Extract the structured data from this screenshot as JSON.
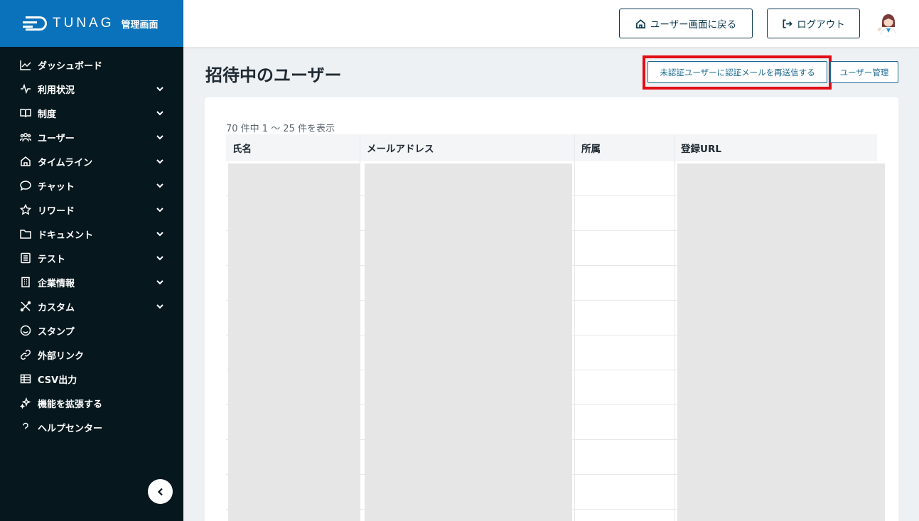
{
  "sidebar": {
    "brand_name": "TUNAG",
    "brand_sub": "管理画面",
    "items": [
      {
        "label": "ダッシュボード",
        "icon": "chart-line-icon",
        "expandable": false
      },
      {
        "label": "利用状況",
        "icon": "pulse-icon",
        "expandable": true
      },
      {
        "label": "制度",
        "icon": "book-icon",
        "expandable": true
      },
      {
        "label": "ユーザー",
        "icon": "users-icon",
        "expandable": true
      },
      {
        "label": "タイムライン",
        "icon": "home-icon",
        "expandable": true
      },
      {
        "label": "チャット",
        "icon": "chat-bubble-icon",
        "expandable": true
      },
      {
        "label": "リワード",
        "icon": "star-icon",
        "expandable": true
      },
      {
        "label": "ドキュメント",
        "icon": "folder-icon",
        "expandable": true
      },
      {
        "label": "テスト",
        "icon": "checklist-icon",
        "expandable": true
      },
      {
        "label": "企業情報",
        "icon": "building-icon",
        "expandable": true
      },
      {
        "label": "カスタム",
        "icon": "tools-icon",
        "expandable": true
      },
      {
        "label": "スタンプ",
        "icon": "smiley-icon",
        "expandable": false
      },
      {
        "label": "外部リンク",
        "icon": "link-icon",
        "expandable": false
      },
      {
        "label": "CSV出力",
        "icon": "table-icon",
        "expandable": false
      },
      {
        "label": "機能を拡張する",
        "icon": "sparkle-icon",
        "expandable": false
      },
      {
        "label": "ヘルプセンター",
        "icon": "question-icon",
        "expandable": false
      }
    ]
  },
  "header": {
    "back_to_user_label": "ユーザー画面に戻る",
    "logout_label": "ログアウト"
  },
  "main": {
    "page_title": "招待中のユーザー",
    "resend_button_label": "未認証ユーザーに認証メールを再送信する",
    "user_mgmt_button_label": "ユーザー管理",
    "count_text": "70 件中 1 〜 25 件を表示",
    "table": {
      "columns": [
        "氏名",
        "メールアドレス",
        "所属",
        "登録URL"
      ],
      "visible_rows": 10
    }
  },
  "colors": {
    "sidebar_bg": "#06171d",
    "brand_bg": "#0a72ba",
    "highlight": "#e30d16",
    "accent": "#1b6a92"
  }
}
